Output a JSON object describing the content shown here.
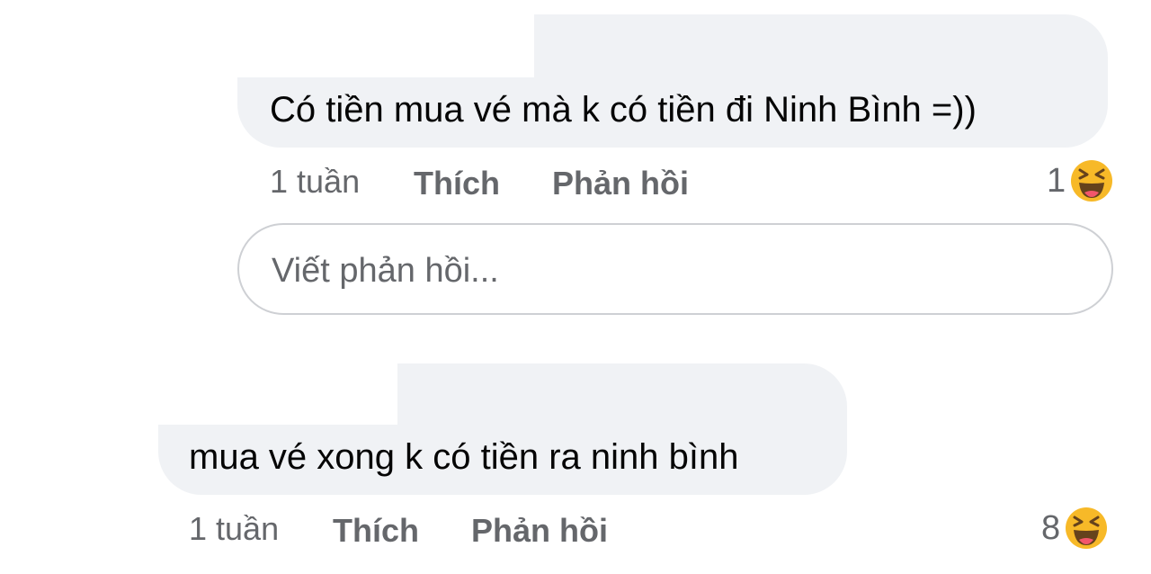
{
  "comments": [
    {
      "text": "Có tiền mua vé mà k có tiền đi Ninh Bình =))",
      "time": "1 tuần",
      "like_label": "Thích",
      "reply_label": "Phản hồi",
      "reaction_count": "1",
      "reaction_icon": "haha-icon"
    },
    {
      "text": "mua vé xong k có tiền ra ninh bình",
      "time": "1 tuần",
      "like_label": "Thích",
      "reply_label": "Phản hồi",
      "reaction_count": "8",
      "reaction_icon": "haha-icon"
    }
  ],
  "reply_input": {
    "placeholder": "Viết phản hồi..."
  },
  "colors": {
    "bubble": "#f0f2f5",
    "text": "#050505",
    "secondary": "#65676b",
    "input_border": "#ced0d4",
    "haha_face": "#f7b928"
  }
}
